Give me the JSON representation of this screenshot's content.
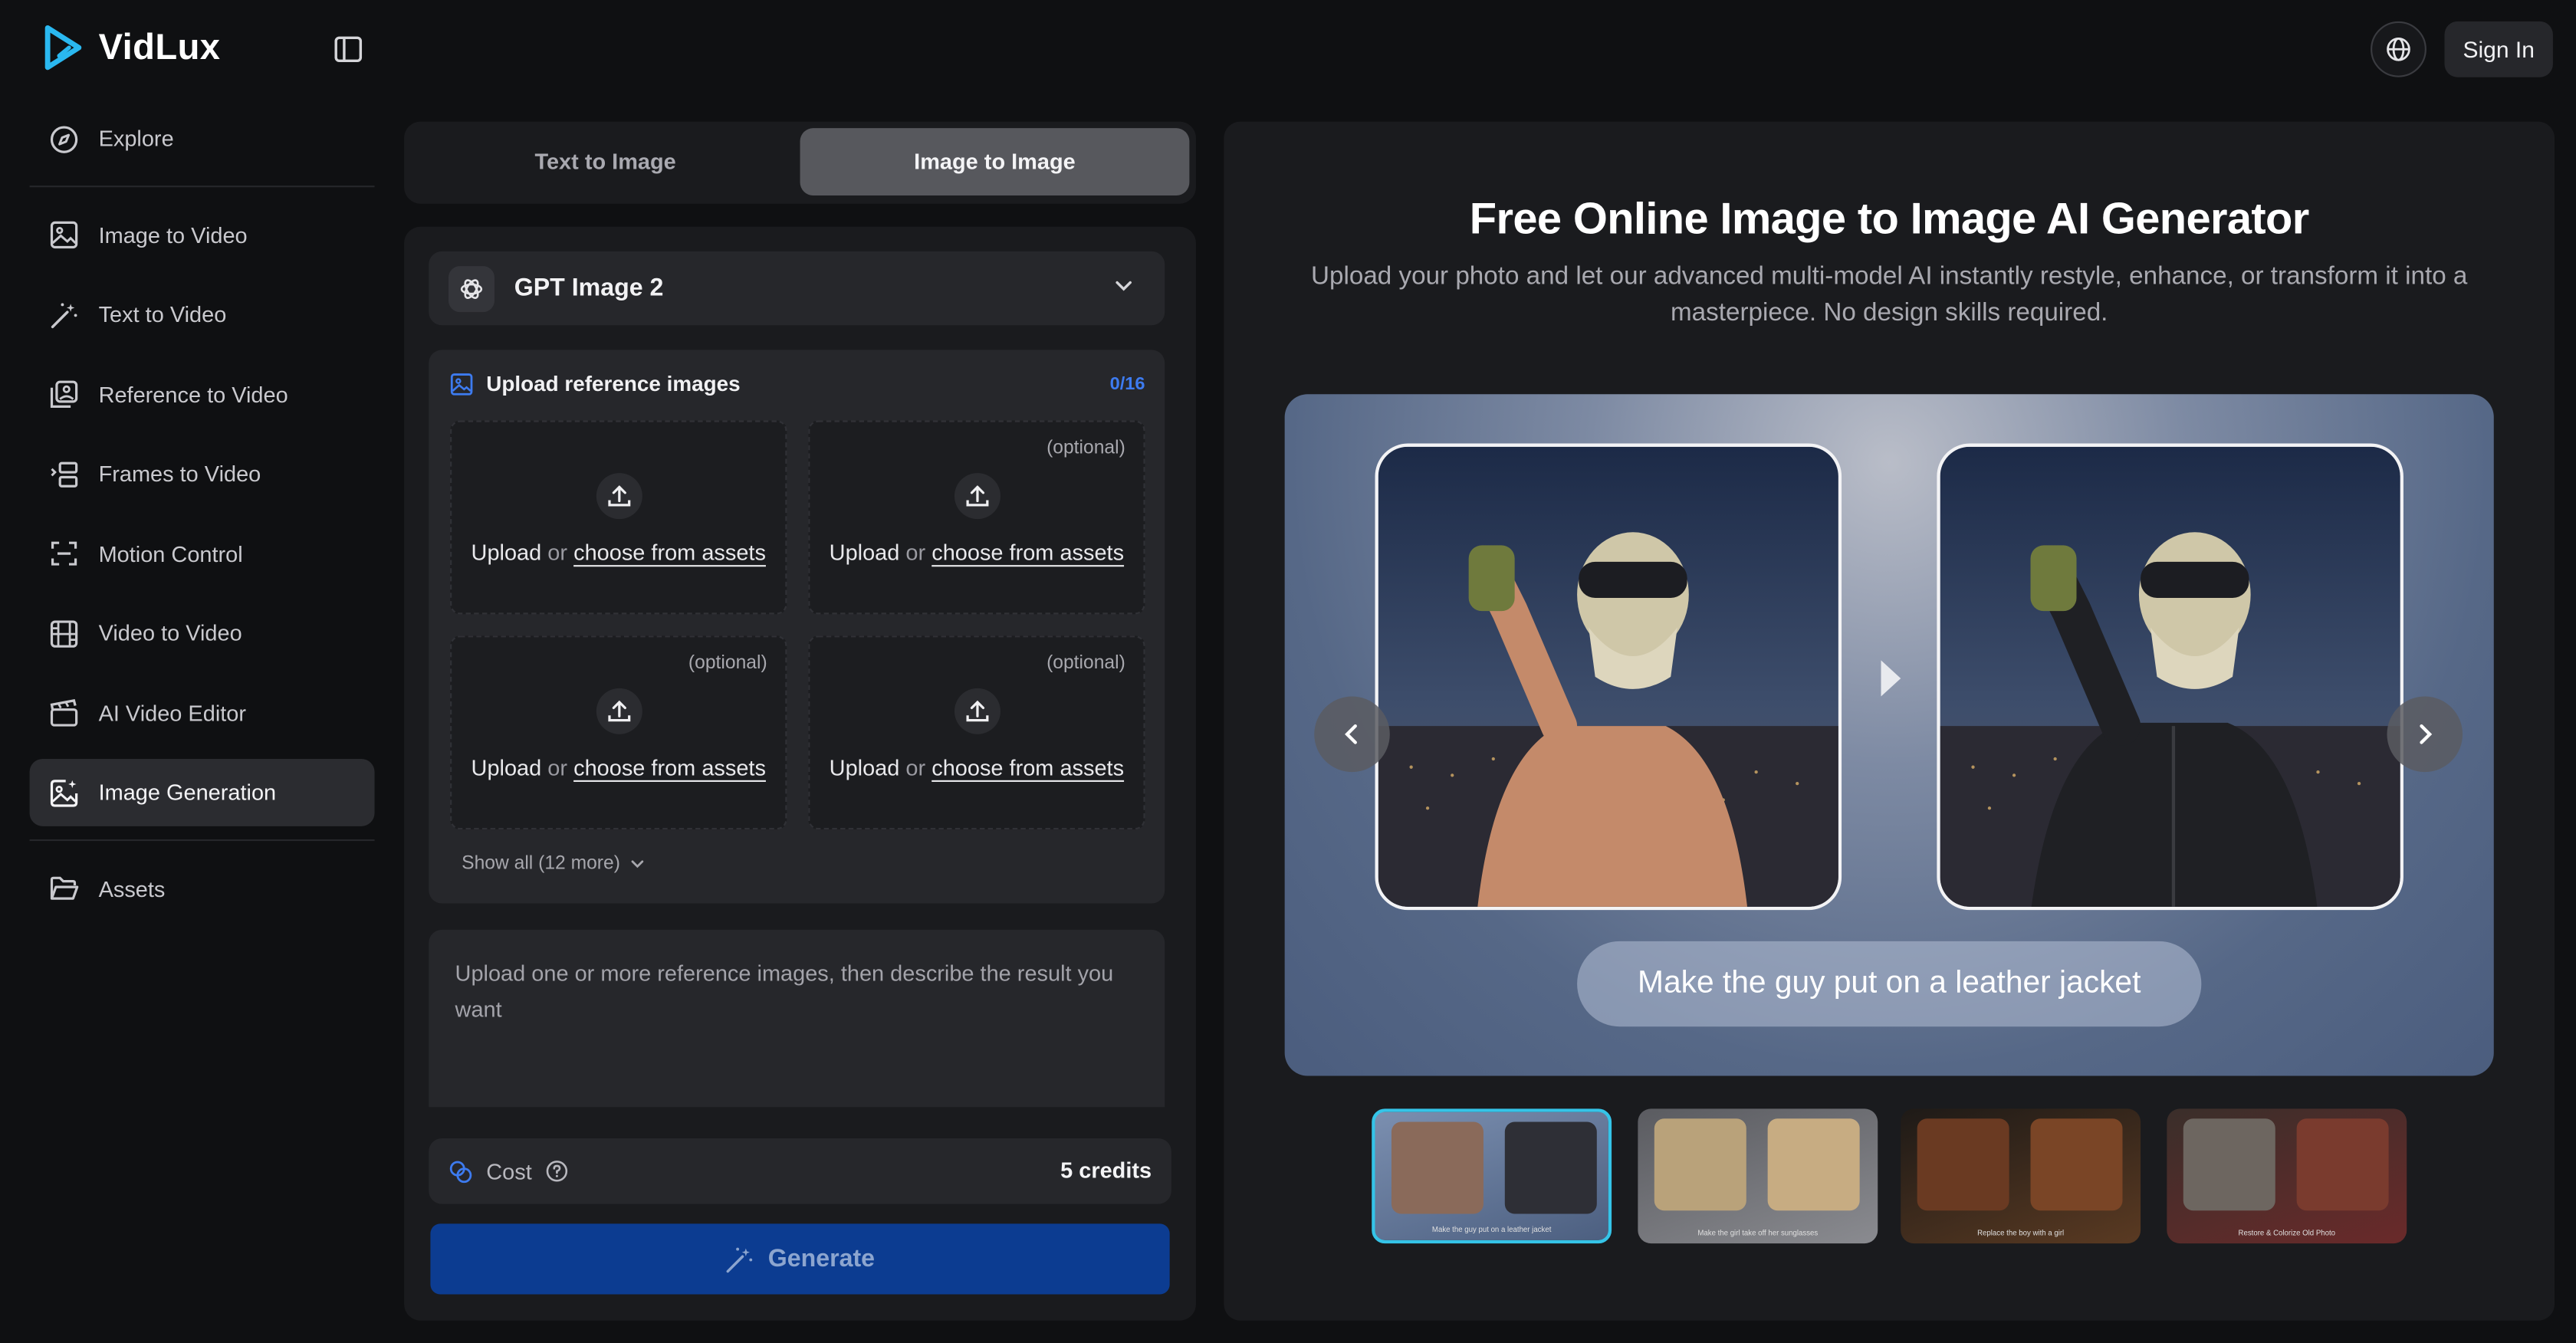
{
  "app": {
    "name": "VidLux"
  },
  "header": {
    "signin_label": "Sign In"
  },
  "sidebar": {
    "items": [
      {
        "label": "Explore",
        "icon": "compass-icon"
      },
      {
        "label": "Image to Video",
        "icon": "image-icon"
      },
      {
        "label": "Text to Video",
        "icon": "magic-wand-icon"
      },
      {
        "label": "Reference to Video",
        "icon": "images-icon"
      },
      {
        "label": "Frames to Video",
        "icon": "frames-icon"
      },
      {
        "label": "Motion Control",
        "icon": "scan-icon"
      },
      {
        "label": "Video to Video",
        "icon": "film-icon"
      },
      {
        "label": "AI Video Editor",
        "icon": "clapperboard-icon"
      },
      {
        "label": "Image Generation",
        "icon": "image-sparkle-icon",
        "active": true
      },
      {
        "label": "Assets",
        "icon": "folder-icon"
      }
    ]
  },
  "tabs": {
    "text_to_image": "Text to Image",
    "image_to_image": "Image to Image",
    "active": "image_to_image"
  },
  "model": {
    "name": "GPT Image 2"
  },
  "upload": {
    "title": "Upload reference images",
    "count": "0/16",
    "slots": [
      {
        "upload": "Upload",
        "or": "or",
        "assets": "choose from assets",
        "optional": ""
      },
      {
        "upload": "Upload",
        "or": "or",
        "assets": "choose from assets",
        "optional": "(optional)"
      },
      {
        "upload": "Upload",
        "or": "or",
        "assets": "choose from assets",
        "optional": "(optional)"
      },
      {
        "upload": "Upload",
        "or": "or",
        "assets": "choose from assets",
        "optional": "(optional)"
      }
    ],
    "show_all": "Show all (12 more)"
  },
  "prompt": {
    "placeholder": "Upload one or more reference images, then describe the result you want"
  },
  "cost": {
    "label": "Cost",
    "value": "5 credits"
  },
  "generate": {
    "label": "Generate"
  },
  "hero": {
    "title": "Free Online Image to Image AI Generator",
    "subtitle": "Upload your photo and let our advanced multi-model AI instantly restyle, enhance, or transform it into a masterpiece. No design skills required."
  },
  "showcase": {
    "caption": "Make the guy put on a leather jacket",
    "thumbs": [
      {
        "caption": "Make the guy put on a leather jacket",
        "selected": true
      },
      {
        "caption": "Make the girl take off her sunglasses",
        "selected": false
      },
      {
        "caption": "Replace the boy with a girl",
        "selected": false
      },
      {
        "caption": "Restore & Colorize Old Photo",
        "selected": false
      }
    ]
  },
  "colors": {
    "accent": "#3d7bf0",
    "generate_bg": "#0c3c91",
    "thumb_selected": "#35c4e8"
  }
}
